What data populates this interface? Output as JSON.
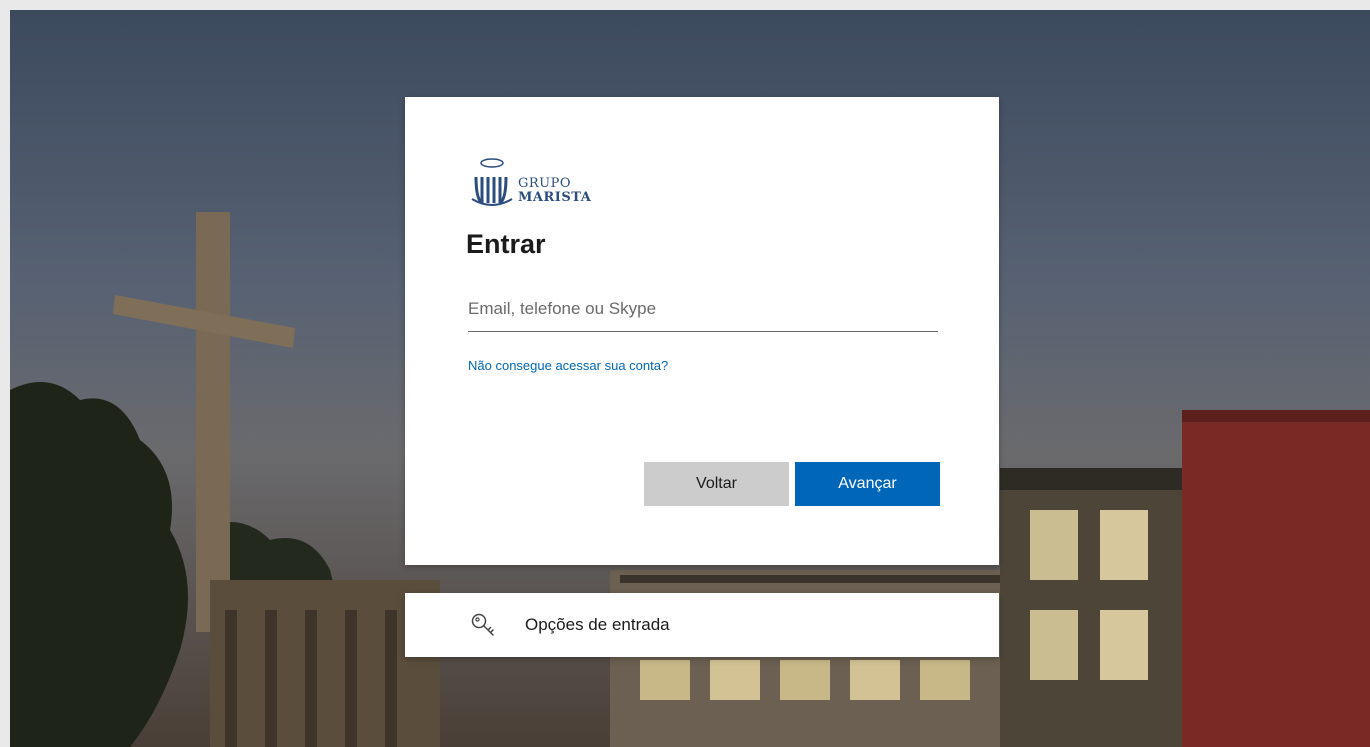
{
  "brand": {
    "logo_line1": "GRUPO",
    "logo_line2": "MARISTA"
  },
  "signin": {
    "title": "Entrar",
    "email_placeholder": "Email, telefone ou Skype",
    "email_value": "",
    "help_link": "Não consegue acessar sua conta?",
    "back_label": "Voltar",
    "next_label": "Avançar"
  },
  "options": {
    "label": "Opções de entrada",
    "icon": "key-icon"
  },
  "colors": {
    "accent": "#0067b8",
    "back_button": "#cccccc",
    "logo": "#2b4c7e"
  }
}
